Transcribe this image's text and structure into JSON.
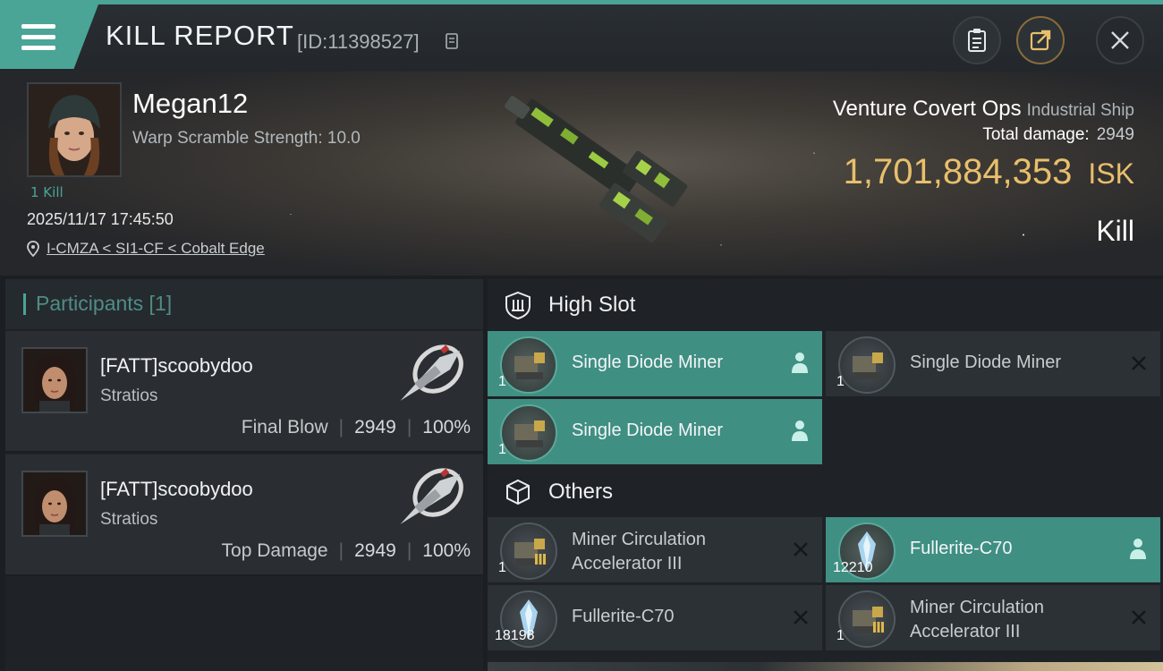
{
  "header": {
    "title": "KILL REPORT",
    "report_id": "[ID:11398527]"
  },
  "victim": {
    "pilot_name": "Megan12",
    "warp_scramble": "Warp Scramble Strength: 10.0",
    "kills": "1 Kill",
    "datetime": "2025/11/17 17:45:50",
    "location": "I-CMZA < SI1-CF < Cobalt Edge",
    "ship_name": "Venture Covert Ops",
    "ship_class": "Industrial Ship",
    "total_damage_label": "Total damage:",
    "total_damage": "2949",
    "isk_value": "1,701,884,353",
    "isk_unit": "ISK",
    "result": "Kill"
  },
  "participants": {
    "title": "Participants [1]",
    "rows": [
      {
        "name": "[FATT]scoobydoo",
        "ship": "Stratios",
        "label": "Final Blow",
        "damage": "2949",
        "percent": "100%"
      },
      {
        "name": "[FATT]scoobydoo",
        "ship": "Stratios",
        "label": "Top Damage",
        "damage": "2949",
        "percent": "100%"
      }
    ]
  },
  "fitting": {
    "high_slot_title": "High Slot",
    "others_title": "Others",
    "high_slots": [
      {
        "name": "Single Diode Miner",
        "qty": "1",
        "state": "fitted"
      },
      {
        "name": "Single Diode Miner",
        "qty": "1",
        "state": "destroyed"
      },
      {
        "name": "Single Diode Miner",
        "qty": "1",
        "state": "fitted"
      }
    ],
    "others": [
      {
        "name": "Miner Circulation Accelerator III",
        "qty": "1",
        "state": "destroyed"
      },
      {
        "name": "Fullerite-C70",
        "qty": "12210",
        "state": "dropped"
      },
      {
        "name": "Fullerite-C70",
        "qty": "18198",
        "state": "destroyed"
      },
      {
        "name": "Miner Circulation Accelerator III",
        "qty": "1",
        "state": "destroyed"
      }
    ]
  },
  "colors": {
    "accent": "#4aa596",
    "isk": "#e8bf6c"
  },
  "icons": [
    "menu-icon",
    "copy-icon",
    "clipboard-icon",
    "export-icon",
    "close-icon",
    "location-pin-icon",
    "shield-slot-icon",
    "cube-icon",
    "person-icon",
    "x-icon"
  ]
}
